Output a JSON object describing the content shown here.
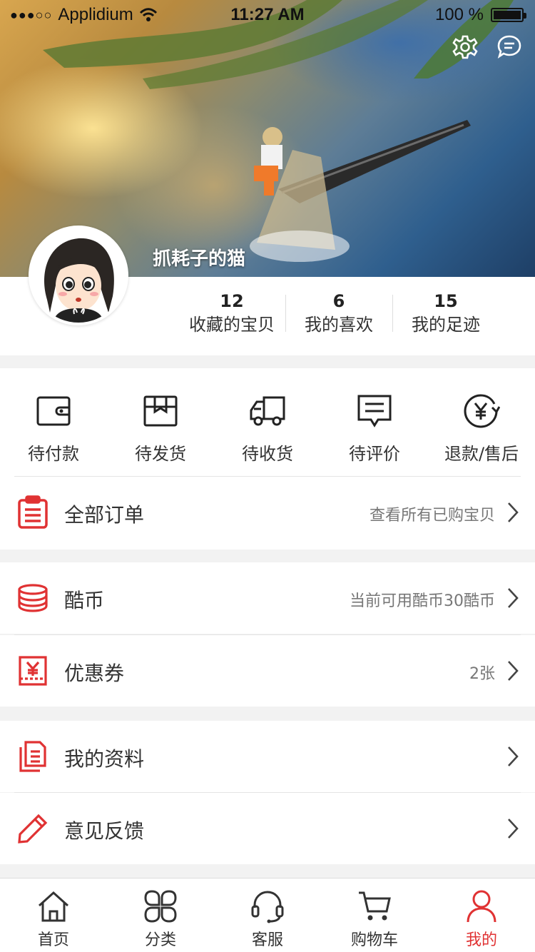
{
  "status_bar": {
    "carrier": "Applidium",
    "signal": "●●●○○",
    "time": "11:27 AM",
    "battery": "100 %"
  },
  "profile": {
    "username": "抓耗子的猫",
    "stats": [
      {
        "value": "12",
        "label": "收藏的宝贝"
      },
      {
        "value": "6",
        "label": "我的喜欢"
      },
      {
        "value": "15",
        "label": "我的足迹"
      }
    ]
  },
  "orders": {
    "statuses": [
      {
        "label": "待付款",
        "icon": "wallet-icon"
      },
      {
        "label": "待发货",
        "icon": "package-icon"
      },
      {
        "label": "待收货",
        "icon": "truck-icon"
      },
      {
        "label": "待评价",
        "icon": "comment-icon"
      },
      {
        "label": "退款/售后",
        "icon": "refund-icon"
      }
    ],
    "all": {
      "label": "全部订单",
      "sub": "查看所有已购宝贝"
    }
  },
  "assets": {
    "coins": {
      "label": "酷币",
      "sub": "当前可用酷币30酷币"
    },
    "coupons": {
      "label": "优惠券",
      "sub": "2张"
    }
  },
  "misc": {
    "profile": {
      "label": "我的资料"
    },
    "feedback": {
      "label": "意见反馈"
    }
  },
  "tabs": [
    {
      "label": "首页",
      "icon": "home-icon"
    },
    {
      "label": "分类",
      "icon": "category-icon"
    },
    {
      "label": "客服",
      "icon": "headset-icon"
    },
    {
      "label": "购物车",
      "icon": "cart-icon"
    },
    {
      "label": "我的",
      "icon": "user-icon"
    }
  ],
  "colors": {
    "accent": "#e03233",
    "text": "#333333",
    "subtext": "#777777",
    "background": "#f2f2f2"
  }
}
